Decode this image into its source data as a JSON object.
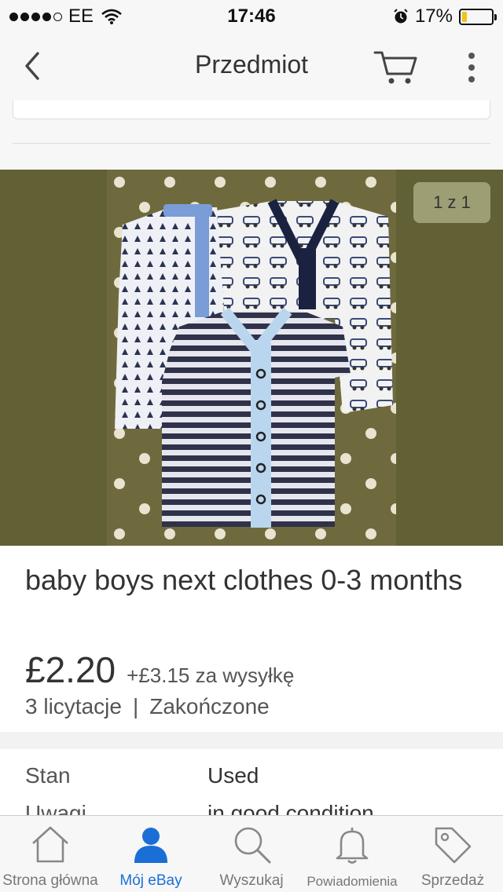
{
  "status_bar": {
    "carrier": "EE",
    "time": "17:46",
    "battery": "17%",
    "battery_level": 0.17,
    "signal_bars_filled": 4
  },
  "nav": {
    "title": "Przedmiot",
    "back_icon": "chevron-left-icon",
    "cart_icon": "cart-icon",
    "more_icon": "more-vertical-icon"
  },
  "gallery": {
    "counter": "1 z 1",
    "background_color": "#616135"
  },
  "item": {
    "title": "baby boys next clothes 0-3 months",
    "price": "£2.20",
    "shipping": "+£3.15 za wysyłkę",
    "bids": "3 licytacje",
    "separator": "|",
    "status": "Zakończone"
  },
  "specs": [
    {
      "label": "Stan",
      "value": "Used"
    },
    {
      "label": "Uwagi",
      "value": "in good condition"
    }
  ],
  "tab_bar": {
    "active_color": "#1a6fd6",
    "tabs": [
      {
        "label": "Strona główna",
        "icon": "home-icon"
      },
      {
        "label": "Mój eBay",
        "icon": "user-icon"
      },
      {
        "label": "Wyszukaj",
        "icon": "search-icon"
      },
      {
        "label": "Powiadomienia",
        "icon": "bell-icon"
      },
      {
        "label": "Sprzedaż",
        "icon": "tag-icon"
      }
    ]
  }
}
